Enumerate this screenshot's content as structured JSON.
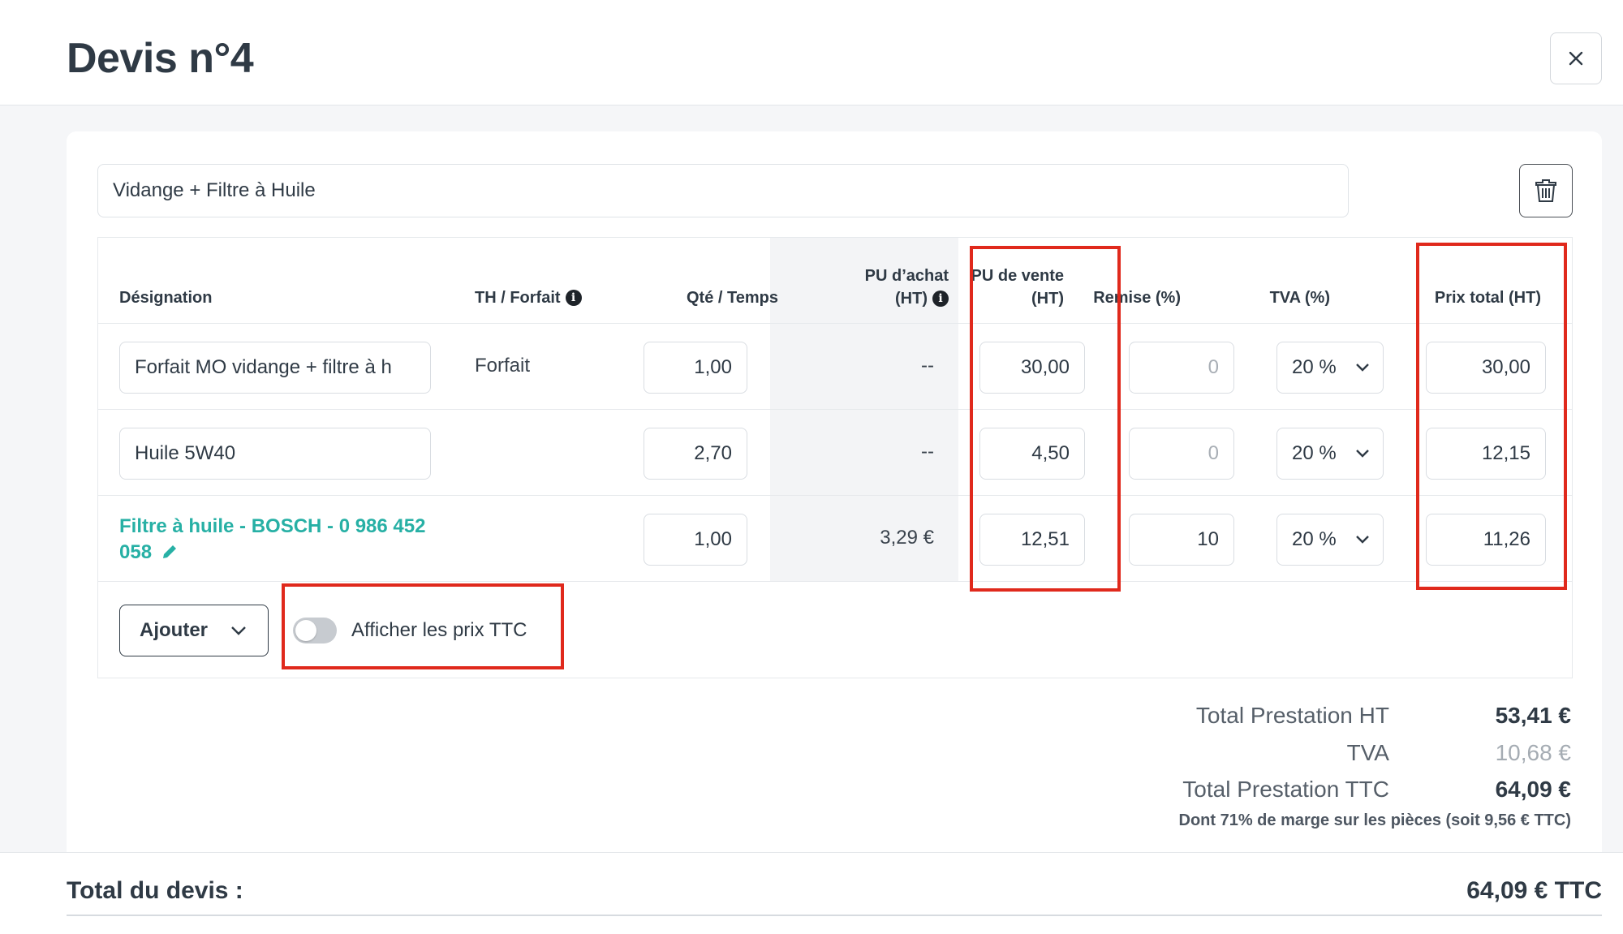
{
  "header": {
    "title": "Devis n°4"
  },
  "service": {
    "title_value": "Vidange + Filtre à Huile"
  },
  "table": {
    "columns": {
      "designation": "Désignation",
      "th_forfait": "TH / Forfait",
      "qty_time": "Qté / Temps",
      "purchase_price_line1": "PU d’achat",
      "purchase_price_line2": "(HT)",
      "selling_price_line1": "PU de vente",
      "selling_price_line2": "(HT)",
      "discount": "Remise (%)",
      "vat": "TVA (%)",
      "total_price": "Prix total (HT)"
    },
    "rows": [
      {
        "designation": "Forfait MO vidange + filtre à h",
        "type": "Forfait",
        "qty": "1,00",
        "purchase": "--",
        "unit_price": "30,00",
        "discount": "0",
        "vat": "20 %",
        "total": "30,00"
      },
      {
        "designation": "Huile 5W40",
        "type": "",
        "qty": "2,70",
        "purchase": "--",
        "unit_price": "4,50",
        "discount": "0",
        "vat": "20 %",
        "total": "12,15"
      },
      {
        "designation": "Filtre à huile - BOSCH - 0 986 452 058",
        "type": "",
        "qty": "1,00",
        "purchase": "3,29 €",
        "unit_price": "12,51",
        "discount": "10",
        "vat": "20 %",
        "total": "11,26"
      }
    ]
  },
  "actions": {
    "add_label": "Ajouter",
    "toggle_label": "Afficher les prix TTC",
    "toggle_on": false
  },
  "totals": {
    "ht_label": "Total Prestation HT",
    "ht_value": "53,41 €",
    "vat_label": "TVA",
    "vat_value": "10,68 €",
    "ttc_label": "Total Prestation TTC",
    "ttc_value": "64,09 €",
    "margin_note": "Dont 71% de marge sur les pièces (soit 9,56 € TTC)"
  },
  "footer": {
    "label": "Total du devis :",
    "value": "64,09 € TTC"
  },
  "colors": {
    "accent_link": "#27b0a5",
    "highlight": "#e0291c",
    "text_dark": "#2f3a45"
  },
  "icons": [
    "close-icon",
    "trash-icon",
    "info-icon",
    "chevron-down-icon",
    "pencil-icon"
  ]
}
